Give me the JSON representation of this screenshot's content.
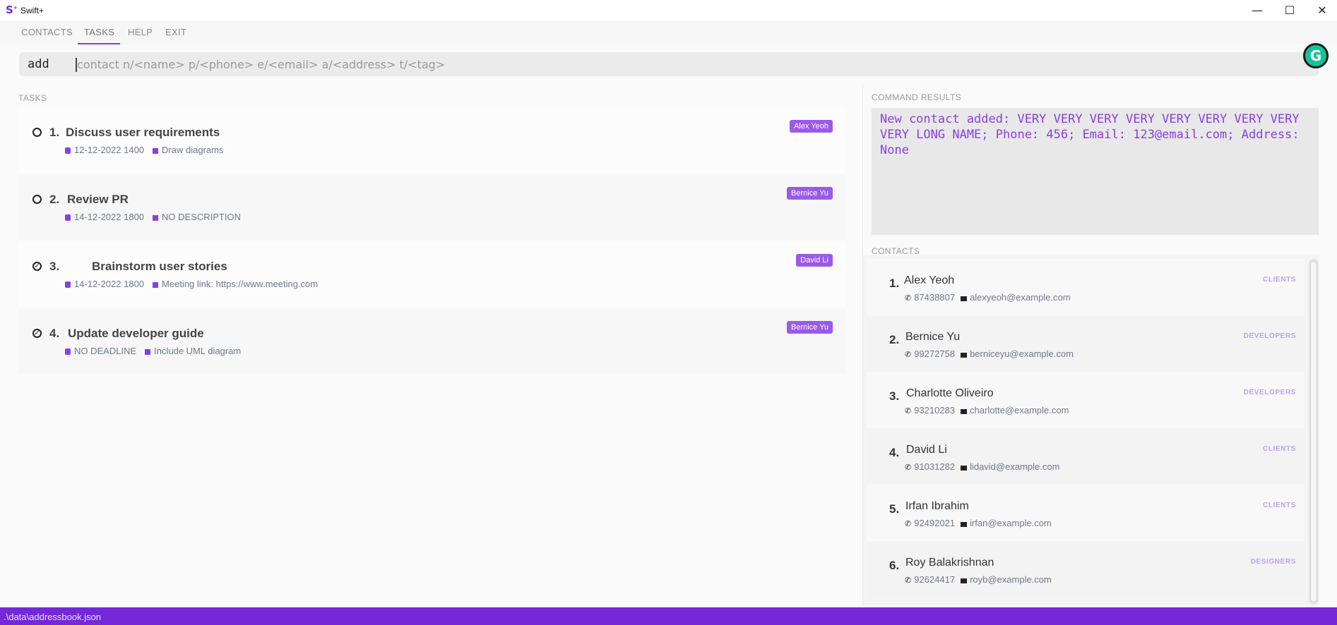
{
  "window": {
    "logo": "S",
    "title": "Swift+",
    "minimize_icon": "—",
    "maximize_icon": "☐",
    "close_icon": "✕"
  },
  "menu": {
    "items": [
      "CONTACTS",
      "TASKS",
      "HELP",
      "EXIT"
    ],
    "active": "TASKS"
  },
  "command": {
    "typed": "add ",
    "hint": "contact n/<name> p/<phone> e/<email> a/<address> t/<tag>"
  },
  "tasks": {
    "header": "TASKS",
    "items": [
      {
        "index": "1.",
        "title": "Discuss user requirements",
        "deadline": "12-12-2022 1400",
        "description": "Draw diagrams",
        "tag": "Alex Yeoh",
        "done": false
      },
      {
        "index": "2.",
        "title": "Review PR",
        "deadline": "14-12-2022 1800",
        "description": "NO DESCRIPTION",
        "tag": "Bernice Yu",
        "done": false
      },
      {
        "index": "3.",
        "title": "Brainstorm user stories",
        "deadline": "14-12-2022 1800",
        "description": "Meeting link: https://www.meeting.com",
        "tag": "David Li",
        "done": true
      },
      {
        "index": "4.",
        "title": "Update developer guide",
        "deadline": "NO DEADLINE",
        "description": "Include UML diagram",
        "tag": "Bernice Yu",
        "done": true
      }
    ]
  },
  "results": {
    "header": "COMMAND RESULTS",
    "text": "New contact added: VERY VERY VERY VERY VERY VERY VERY VERY VERY LONG NAME; Phone: 456; Email: 123@email.com; Address: None"
  },
  "contacts": {
    "header": "CONTACTS",
    "items": [
      {
        "index": "1.",
        "name": "Alex Yeoh",
        "phone": "87438807",
        "email": "alexyeoh@example.com",
        "tag": "CLIENTS"
      },
      {
        "index": "2.",
        "name": "Bernice Yu",
        "phone": "99272758",
        "email": "berniceyu@example.com",
        "tag": "DEVELOPERS"
      },
      {
        "index": "3.",
        "name": "Charlotte Oliveiro",
        "phone": "93210283",
        "email": "charlotte@example.com",
        "tag": "DEVELOPERS"
      },
      {
        "index": "4.",
        "name": "David Li",
        "phone": "91031282",
        "email": "lidavid@example.com",
        "tag": "CLIENTS"
      },
      {
        "index": "5.",
        "name": "Irfan Ibrahim",
        "phone": "92492021",
        "email": "irfan@example.com",
        "tag": "CLIENTS"
      },
      {
        "index": "6.",
        "name": "Roy Balakrishnan",
        "phone": "92624417",
        "email": "royb@example.com",
        "tag": "DESIGNERS"
      }
    ]
  },
  "status": {
    "path": ".\\data\\addressbook.json"
  },
  "colors": {
    "accent": "#8a3fe0",
    "status_bar": "#7428d9",
    "tag_bg": "#9a5ae8"
  }
}
